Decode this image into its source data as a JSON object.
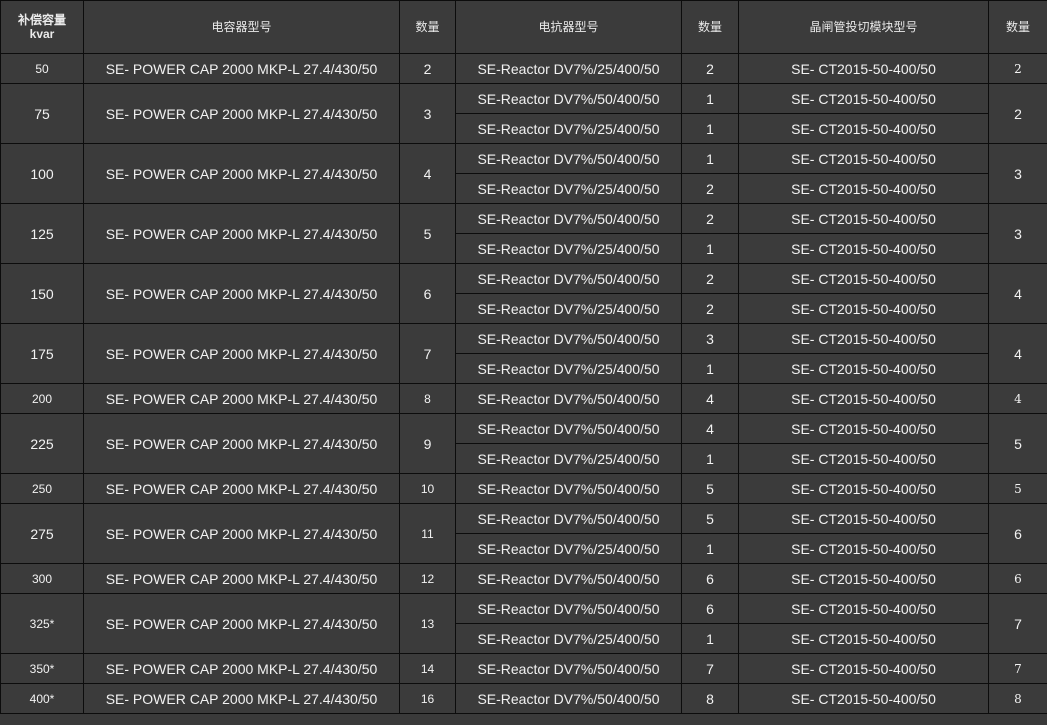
{
  "headers": {
    "capacity_line1": "补偿容量",
    "capacity_line2": "kvar",
    "capacitor_model": "电容器型号",
    "qty1": "数量",
    "reactor_model": "电抗器型号",
    "qty2": "数量",
    "thyristor_model": "晶闸管投切模块型号",
    "qty3": "数量"
  },
  "rows": [
    {
      "kvar": "50",
      "cap": "SE- POWER CAP 2000 MKP-L 27.4/430/50",
      "cap_qty": "2",
      "reactors": [
        {
          "model": "SE-Reactor DV7%/25/400/50",
          "qty": "2",
          "thy": "SE- CT2015-50-400/50"
        }
      ],
      "thy_qty": "2"
    },
    {
      "kvar": "75",
      "cap": "SE- POWER CAP 2000 MKP-L 27.4/430/50",
      "cap_qty": "3",
      "reactors": [
        {
          "model": "SE-Reactor DV7%/50/400/50",
          "qty": "1",
          "thy": "SE- CT2015-50-400/50"
        },
        {
          "model": "SE-Reactor DV7%/25/400/50",
          "qty": "1",
          "thy": "SE- CT2015-50-400/50"
        }
      ],
      "thy_qty": "2"
    },
    {
      "kvar": "100",
      "cap": "SE- POWER CAP 2000 MKP-L 27.4/430/50",
      "cap_qty": "4",
      "reactors": [
        {
          "model": "SE-Reactor DV7%/50/400/50",
          "qty": "1",
          "thy": "SE- CT2015-50-400/50"
        },
        {
          "model": "SE-Reactor DV7%/25/400/50",
          "qty": "2",
          "thy": "SE- CT2015-50-400/50"
        }
      ],
      "thy_qty": "3"
    },
    {
      "kvar": "125",
      "cap": "SE- POWER CAP 2000 MKP-L 27.4/430/50",
      "cap_qty": "5",
      "reactors": [
        {
          "model": "SE-Reactor DV7%/50/400/50",
          "qty": "2",
          "thy": "SE- CT2015-50-400/50"
        },
        {
          "model": "SE-Reactor DV7%/25/400/50",
          "qty": "1",
          "thy": "SE- CT2015-50-400/50"
        }
      ],
      "thy_qty": "3"
    },
    {
      "kvar": "150",
      "cap": "SE- POWER CAP 2000 MKP-L 27.4/430/50",
      "cap_qty": "6",
      "reactors": [
        {
          "model": "SE-Reactor DV7%/50/400/50",
          "qty": "2",
          "thy": "SE- CT2015-50-400/50"
        },
        {
          "model": "SE-Reactor DV7%/25/400/50",
          "qty": "2",
          "thy": "SE- CT2015-50-400/50"
        }
      ],
      "thy_qty": "4"
    },
    {
      "kvar": "175",
      "cap": "SE- POWER CAP 2000 MKP-L 27.4/430/50",
      "cap_qty": "7",
      "reactors": [
        {
          "model": "SE-Reactor DV7%/50/400/50",
          "qty": "3",
          "thy": "SE- CT2015-50-400/50"
        },
        {
          "model": "SE-Reactor DV7%/25/400/50",
          "qty": "1",
          "thy": "SE- CT2015-50-400/50"
        }
      ],
      "thy_qty": "4"
    },
    {
      "kvar": "200",
      "cap": "SE- POWER CAP 2000 MKP-L 27.4/430/50",
      "cap_qty": "8",
      "reactors": [
        {
          "model": "SE-Reactor DV7%/50/400/50",
          "qty": "4",
          "thy": "SE- CT2015-50-400/50"
        }
      ],
      "thy_qty": "4"
    },
    {
      "kvar": "225",
      "cap": "SE- POWER CAP 2000 MKP-L 27.4/430/50",
      "cap_qty": "9",
      "reactors": [
        {
          "model": "SE-Reactor DV7%/50/400/50",
          "qty": "4",
          "thy": "SE- CT2015-50-400/50"
        },
        {
          "model": "SE-Reactor DV7%/25/400/50",
          "qty": "1",
          "thy": "SE- CT2015-50-400/50"
        }
      ],
      "thy_qty": "5"
    },
    {
      "kvar": "250",
      "cap": "SE- POWER CAP 2000 MKP-L 27.4/430/50",
      "cap_qty": "10",
      "reactors": [
        {
          "model": "SE-Reactor DV7%/50/400/50",
          "qty": "5",
          "thy": "SE- CT2015-50-400/50"
        }
      ],
      "thy_qty": "5"
    },
    {
      "kvar": "275",
      "cap": "SE- POWER CAP 2000 MKP-L 27.4/430/50",
      "cap_qty": "11",
      "reactors": [
        {
          "model": "SE-Reactor DV7%/50/400/50",
          "qty": "5",
          "thy": "SE- CT2015-50-400/50"
        },
        {
          "model": "SE-Reactor DV7%/25/400/50",
          "qty": "1",
          "thy": "SE- CT2015-50-400/50"
        }
      ],
      "thy_qty": "6"
    },
    {
      "kvar": "300",
      "cap": "SE- POWER CAP 2000 MKP-L 27.4/430/50",
      "cap_qty": "12",
      "reactors": [
        {
          "model": "SE-Reactor DV7%/50/400/50",
          "qty": "6",
          "thy": "SE- CT2015-50-400/50"
        }
      ],
      "thy_qty": "6"
    },
    {
      "kvar": "325*",
      "cap": "SE- POWER CAP 2000 MKP-L 27.4/430/50",
      "cap_qty": "13",
      "reactors": [
        {
          "model": "SE-Reactor DV7%/50/400/50",
          "qty": "6",
          "thy": "SE- CT2015-50-400/50"
        },
        {
          "model": "SE-Reactor DV7%/25/400/50",
          "qty": "1",
          "thy": "SE- CT2015-50-400/50"
        }
      ],
      "thy_qty": "7"
    },
    {
      "kvar": "350*",
      "cap": "SE- POWER CAP 2000 MKP-L 27.4/430/50",
      "cap_qty": "14",
      "reactors": [
        {
          "model": "SE-Reactor DV7%/50/400/50",
          "qty": "7",
          "thy": "SE- CT2015-50-400/50"
        }
      ],
      "thy_qty": "7"
    },
    {
      "kvar": "400*",
      "cap": "SE- POWER CAP 2000 MKP-L 27.4/430/50",
      "cap_qty": "16",
      "reactors": [
        {
          "model": "SE-Reactor DV7%/50/400/50",
          "qty": "8",
          "thy": "SE- CT2015-50-400/50"
        }
      ],
      "thy_qty": "8"
    }
  ]
}
